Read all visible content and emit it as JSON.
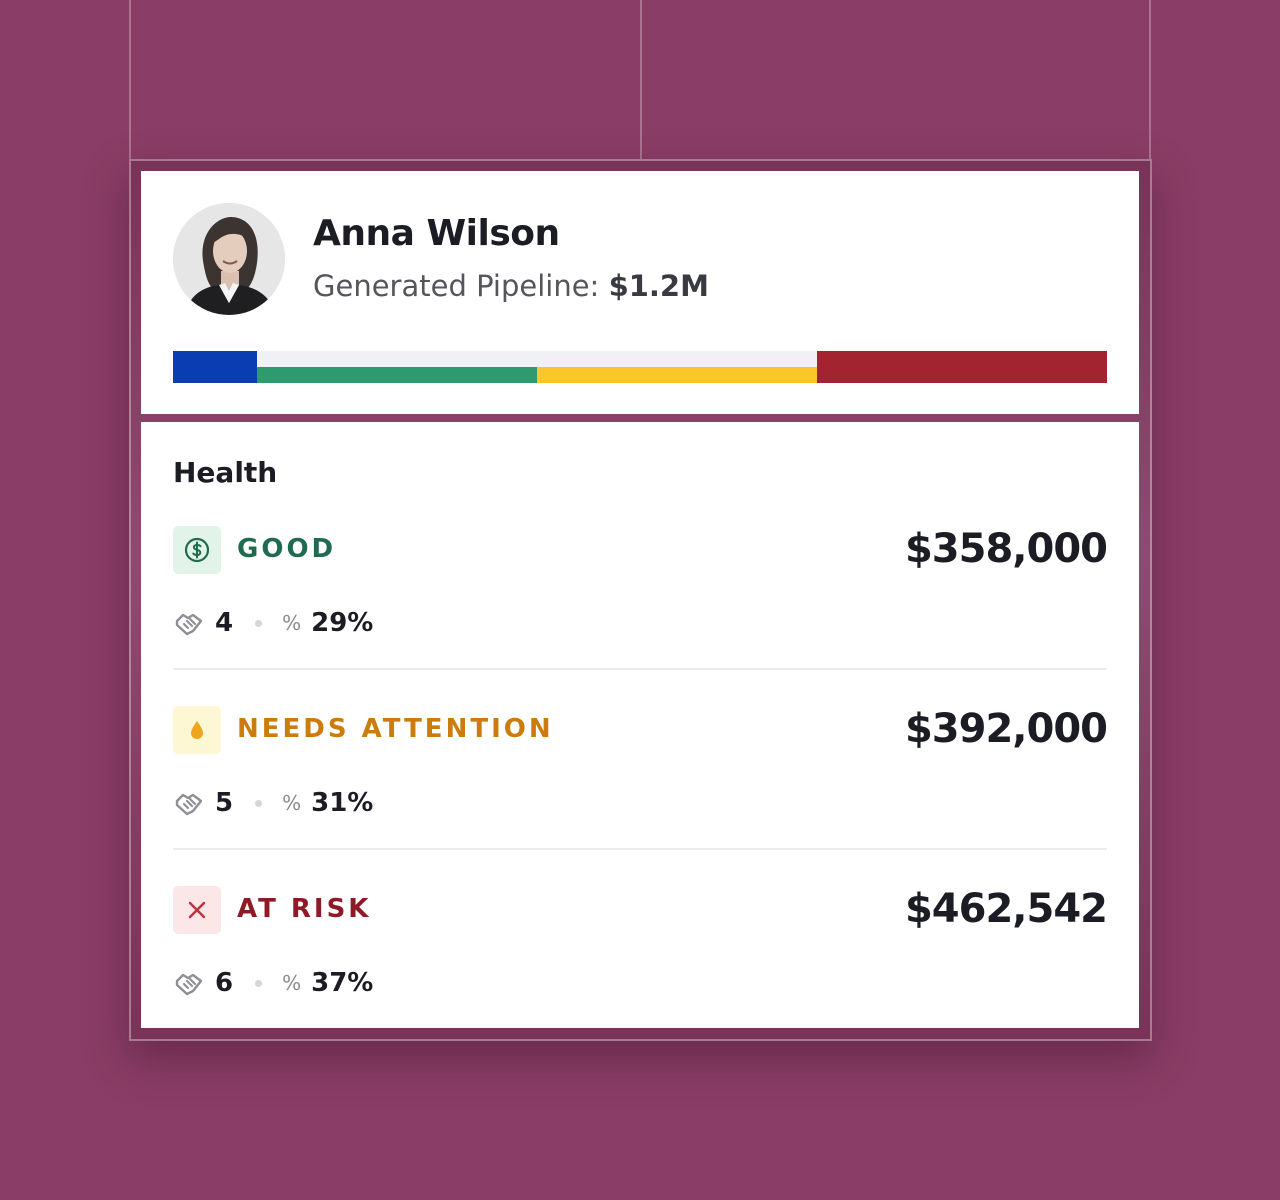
{
  "profile": {
    "name": "Anna Wilson",
    "pipeline_label": "Generated Pipeline:",
    "pipeline_value": "$1.2M"
  },
  "pipeline_bar": {
    "segments": [
      {
        "color": "#0a3db2",
        "fraction": 0.09
      },
      {
        "color": "#2e9a6f",
        "fraction": 0.3
      },
      {
        "color": "#fcc62a",
        "fraction": 0.3
      },
      {
        "color": "#a32431",
        "fraction": 0.31
      }
    ],
    "track_color": "#f1f0f5"
  },
  "health": {
    "title": "Health",
    "rows": [
      {
        "status": "GOOD",
        "amount": "$358,000",
        "deals": "4",
        "percent": "29%",
        "status_color": "#1f6b4f",
        "icon_bg": "#e2f3ea",
        "icon": "dollar-circle-icon"
      },
      {
        "status": "NEEDS ATTENTION",
        "amount": "$392,000",
        "deals": "5",
        "percent": "31%",
        "status_color": "#cc7c0a",
        "icon_bg": "#fdf7d4",
        "icon": "droplet-icon"
      },
      {
        "status": "AT RISK",
        "amount": "$462,542",
        "deals": "6",
        "percent": "37%",
        "status_color": "#8e1a28",
        "icon_bg": "#fbe6e8",
        "icon": "close-x-icon"
      }
    ],
    "percent_symbol": "%"
  },
  "colors": {
    "background": "#8a3d66",
    "card": "#ffffff",
    "text": "#1c1c24"
  }
}
